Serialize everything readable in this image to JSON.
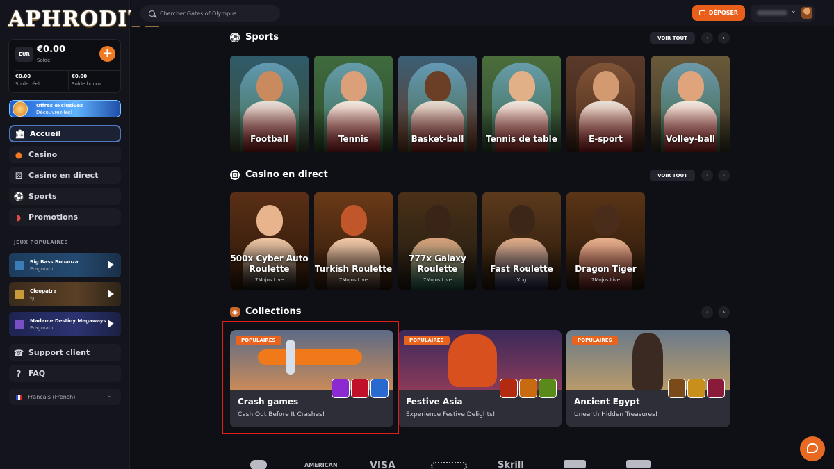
{
  "brand": {
    "logo": "APHRODITE"
  },
  "wallet": {
    "currency": "EUR",
    "balance": "€0.00",
    "balance_label": "Solde",
    "real_value": "€0.00",
    "real_label": "Solde réel",
    "bonus_value": "€0.00",
    "bonus_label": "Solde bonus"
  },
  "offer": {
    "line1": "Offres exclusives",
    "line2": "Découvrez-les!"
  },
  "nav": {
    "home": "Accueil",
    "casino": "Casino",
    "live": "Casino en direct",
    "sports": "Sports",
    "promotions": "Promotions",
    "support": "Support client",
    "faq": "FAQ"
  },
  "popular": {
    "label": "JEUX POPULAIRES",
    "games": [
      {
        "name": "Big Bass Bonanza",
        "provider": "Pragmatic"
      },
      {
        "name": "Cleopatra",
        "provider": "Igt"
      },
      {
        "name": "Madame Destiny Megaways",
        "provider": "Pragmatic"
      }
    ]
  },
  "language": "Français (French)",
  "search": {
    "placeholder": "Chercher Gates of Olympus"
  },
  "header": {
    "deposit_label": "DÉPOSER"
  },
  "sports": {
    "title": "Sports",
    "see_all": "VOIR TOUT",
    "tiles": [
      "Football",
      "Tennis",
      "Basket-ball",
      "Tennis de table",
      "E-sport",
      "Volley-ball"
    ]
  },
  "live_casino": {
    "title": "Casino en direct",
    "see_all": "VOIR TOUT",
    "tiles": [
      {
        "name": "500x Cyber Auto Roulette",
        "provider": "7Mojos Live"
      },
      {
        "name": "Turkish Roulette",
        "provider": "7Mojos Live"
      },
      {
        "name": "777x Galaxy Roulette",
        "provider": "7Mojos Live"
      },
      {
        "name": "Fast Roulette",
        "provider": "Xpg"
      },
      {
        "name": "Dragon Tiger",
        "provider": "7Mojos Live"
      }
    ]
  },
  "collections": {
    "title": "Collections",
    "items": [
      {
        "badge": "POPULAIRES",
        "name": "Crash games",
        "subtitle": "Cash Out Before It Crashes!"
      },
      {
        "badge": "POPULAIRES",
        "name": "Festive Asia",
        "subtitle": "Experience Festive Delights!"
      },
      {
        "badge": "POPULAIRES",
        "name": "Ancient Egypt",
        "subtitle": "Unearth Hidden Treasures!"
      }
    ]
  },
  "payments": [
    "AMERICAN",
    "VISA",
    "Skrill"
  ],
  "colors": {
    "accent": "#e85e1a",
    "highlight": "#e01c1c",
    "active_border": "#4f78ba"
  }
}
